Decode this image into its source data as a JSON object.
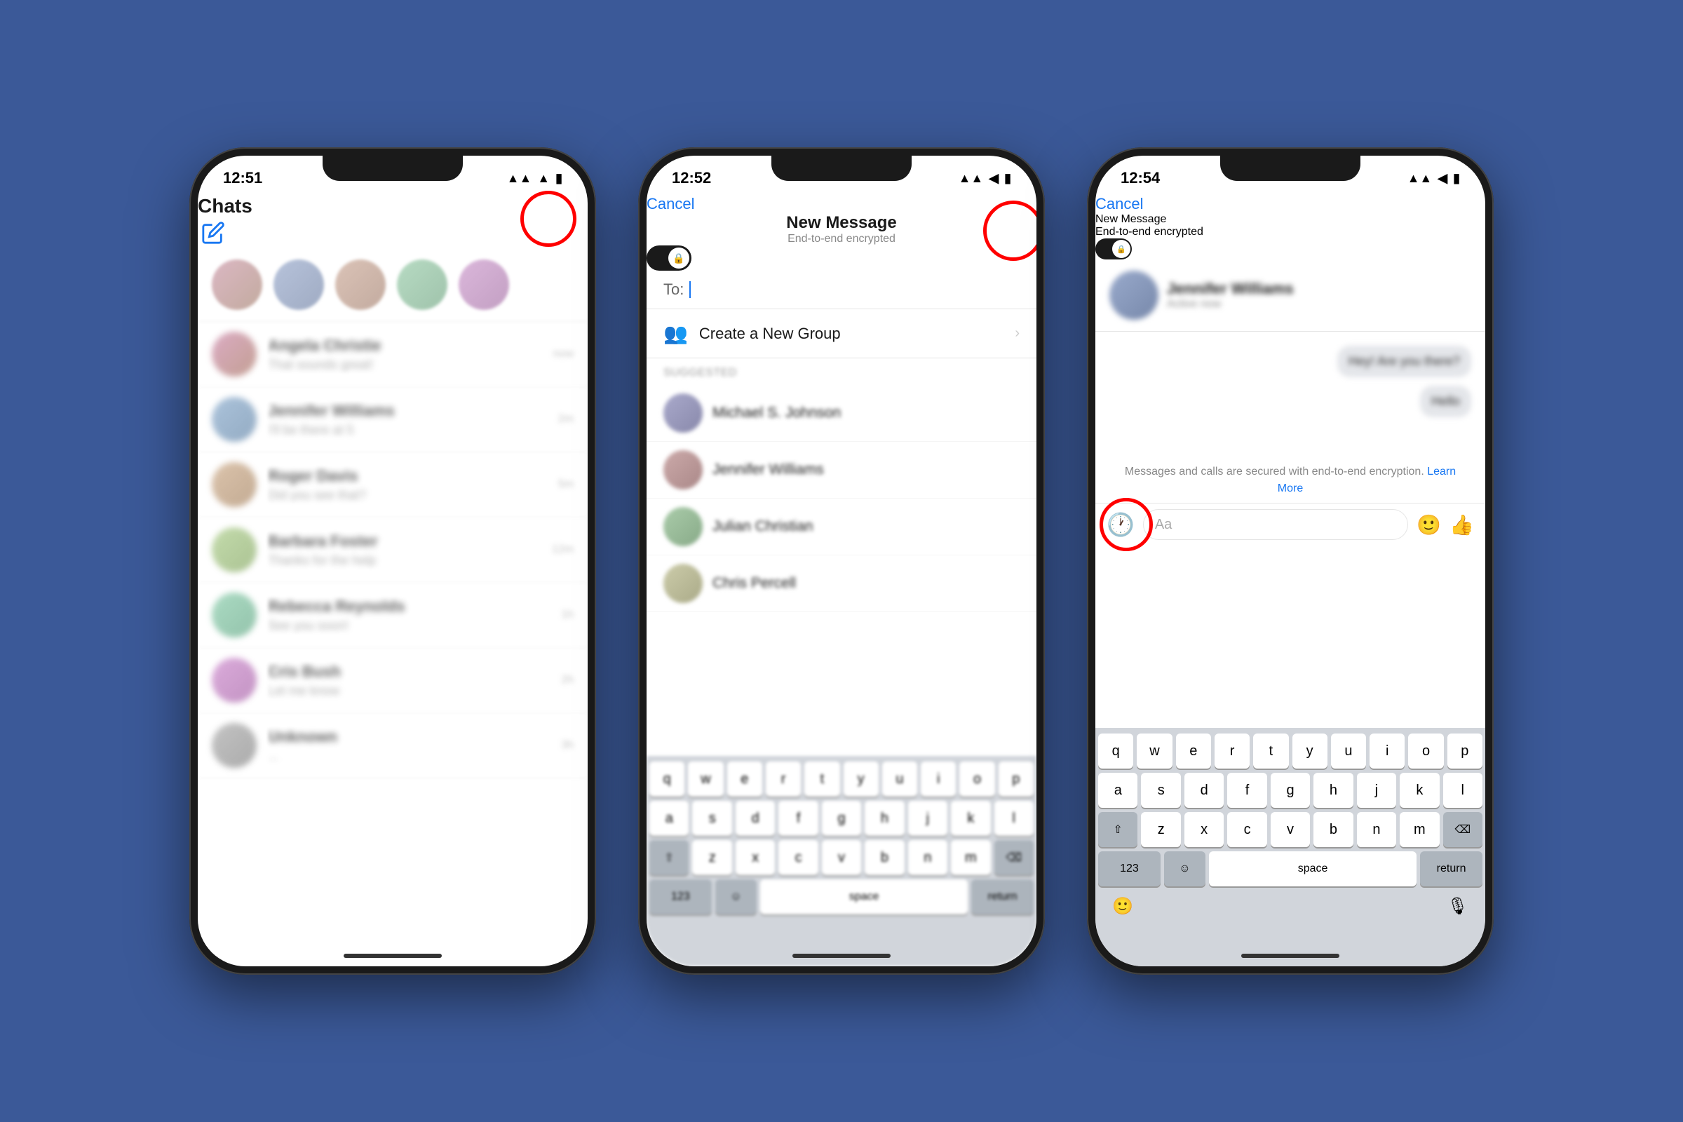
{
  "background": "#3b5998",
  "phone1": {
    "time": "12:51",
    "title": "Chats",
    "stories": [
      "avatar1",
      "avatar2",
      "avatar3",
      "avatar4",
      "avatar5"
    ],
    "chats": [
      {
        "name": "Angela Christie",
        "preview": "That sounds great!",
        "time": "now"
      },
      {
        "name": "Jennifer Williams",
        "preview": "I'll be there at 5",
        "time": "2m"
      },
      {
        "name": "Roger Davis",
        "preview": "Did you see that?",
        "time": "5m"
      },
      {
        "name": "Barbara Foster",
        "preview": "Thanks for the help",
        "time": "12m"
      },
      {
        "name": "Rebecca Reynolds",
        "preview": "See you soon!",
        "time": "1h"
      },
      {
        "name": "Cris Bush",
        "preview": "Let me know",
        "time": "2h"
      },
      {
        "name": "Unknown",
        "preview": "...",
        "time": "3h"
      }
    ]
  },
  "phone2": {
    "time": "12:52",
    "cancel_label": "Cancel",
    "title": "New Message",
    "subtitle": "End-to-end encrypted",
    "to_label": "To:",
    "create_group_label": "Create a New Group",
    "section_label": "SUGGESTED",
    "contacts": [
      {
        "name": "Michael S. Johnson"
      },
      {
        "name": "Jennifer Williams"
      },
      {
        "name": "Julian Christian"
      },
      {
        "name": "Chris Percell"
      }
    ],
    "keyboard_rows": [
      [
        "q",
        "w",
        "e",
        "r",
        "t",
        "y",
        "u",
        "i",
        "o",
        "p"
      ],
      [
        "a",
        "s",
        "d",
        "f",
        "g",
        "h",
        "j",
        "k",
        "l"
      ],
      [
        "z",
        "x",
        "c",
        "v",
        "b",
        "n",
        "m"
      ]
    ]
  },
  "phone3": {
    "time": "12:54",
    "cancel_label": "Cancel",
    "title": "New Message",
    "subtitle": "End-to-end encrypted",
    "encryption_notice": "Messages and calls are secured with end-to-end encryption.",
    "learn_more": "Learn More",
    "keyboard_rows": [
      [
        "q",
        "w",
        "e",
        "r",
        "t",
        "y",
        "u",
        "i",
        "o",
        "p"
      ],
      [
        "a",
        "s",
        "d",
        "f",
        "g",
        "h",
        "j",
        "k",
        "l"
      ],
      [
        "z",
        "x",
        "c",
        "v",
        "b",
        "n",
        "m"
      ]
    ],
    "key_123": "123",
    "key_space": "space",
    "key_return": "return"
  }
}
